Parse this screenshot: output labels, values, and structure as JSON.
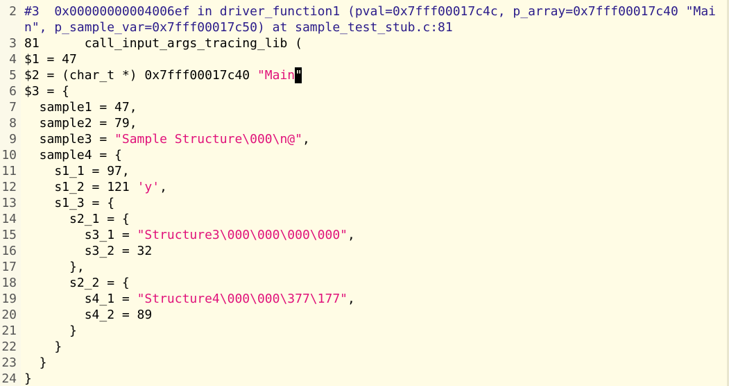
{
  "editor": {
    "top_sliver": "                          (),     ,",
    "lines": [
      {
        "num": "2",
        "segments": [
          {
            "t": "#3  0x00000000004006ef in driver_function1 (pval=0x7fff00017c4c, p_array=0x7fff00017c40 \"Mai",
            "c": "kw"
          }
        ]
      },
      {
        "num": "",
        "segments": [
          {
            "t": "n\", p_sample_var=0x7fff00017c50) at sample_test_stub.c:81",
            "c": "kw"
          }
        ]
      },
      {
        "num": "3",
        "segments": [
          {
            "t": "81      call_input_args_tracing_lib (",
            "c": ""
          }
        ]
      },
      {
        "num": "4",
        "segments": [
          {
            "t": "$1 = 47",
            "c": ""
          }
        ]
      },
      {
        "num": "5",
        "segments": [
          {
            "t": "$2 = (char_t *) 0x7fff00017c40 ",
            "c": ""
          },
          {
            "t": "\"Main",
            "c": "str"
          },
          {
            "t": "\"",
            "c": "cursor"
          }
        ]
      },
      {
        "num": "6",
        "segments": [
          {
            "t": "$3 = {",
            "c": ""
          }
        ]
      },
      {
        "num": "7",
        "segments": [
          {
            "t": "  sample1 = 47,",
            "c": ""
          }
        ]
      },
      {
        "num": "8",
        "segments": [
          {
            "t": "  sample2 = 79,",
            "c": ""
          }
        ]
      },
      {
        "num": "9",
        "segments": [
          {
            "t": "  sample3 = ",
            "c": ""
          },
          {
            "t": "\"Sample Structure\\000\\n@\"",
            "c": "str"
          },
          {
            "t": ",",
            "c": ""
          }
        ]
      },
      {
        "num": "10",
        "segments": [
          {
            "t": "  sample4 = {",
            "c": ""
          }
        ]
      },
      {
        "num": "11",
        "segments": [
          {
            "t": "    s1_1 = 97,",
            "c": ""
          }
        ]
      },
      {
        "num": "12",
        "segments": [
          {
            "t": "    s1_2 = 121 ",
            "c": ""
          },
          {
            "t": "'y'",
            "c": "str"
          },
          {
            "t": ",",
            "c": ""
          }
        ]
      },
      {
        "num": "13",
        "segments": [
          {
            "t": "    s1_3 = {",
            "c": ""
          }
        ]
      },
      {
        "num": "14",
        "segments": [
          {
            "t": "      s2_1 = {",
            "c": ""
          }
        ]
      },
      {
        "num": "15",
        "segments": [
          {
            "t": "        s3_1 = ",
            "c": ""
          },
          {
            "t": "\"Structure3\\000\\000\\000\\000\"",
            "c": "str"
          },
          {
            "t": ",",
            "c": ""
          }
        ]
      },
      {
        "num": "16",
        "segments": [
          {
            "t": "        s3_2 = 32",
            "c": ""
          }
        ]
      },
      {
        "num": "17",
        "segments": [
          {
            "t": "      },",
            "c": ""
          }
        ]
      },
      {
        "num": "18",
        "segments": [
          {
            "t": "      s2_2 = {",
            "c": ""
          }
        ]
      },
      {
        "num": "19",
        "segments": [
          {
            "t": "        s4_1 = ",
            "c": ""
          },
          {
            "t": "\"Structure4\\000\\000\\377\\177\"",
            "c": "str"
          },
          {
            "t": ",",
            "c": ""
          }
        ]
      },
      {
        "num": "20",
        "segments": [
          {
            "t": "        s4_2 = 89",
            "c": ""
          }
        ]
      },
      {
        "num": "21",
        "segments": [
          {
            "t": "      }",
            "c": ""
          }
        ]
      },
      {
        "num": "22",
        "segments": [
          {
            "t": "    }",
            "c": ""
          }
        ]
      },
      {
        "num": "23",
        "segments": [
          {
            "t": "  }",
            "c": ""
          }
        ]
      },
      {
        "num": "24",
        "segments": [
          {
            "t": "}",
            "c": ""
          }
        ]
      }
    ]
  }
}
